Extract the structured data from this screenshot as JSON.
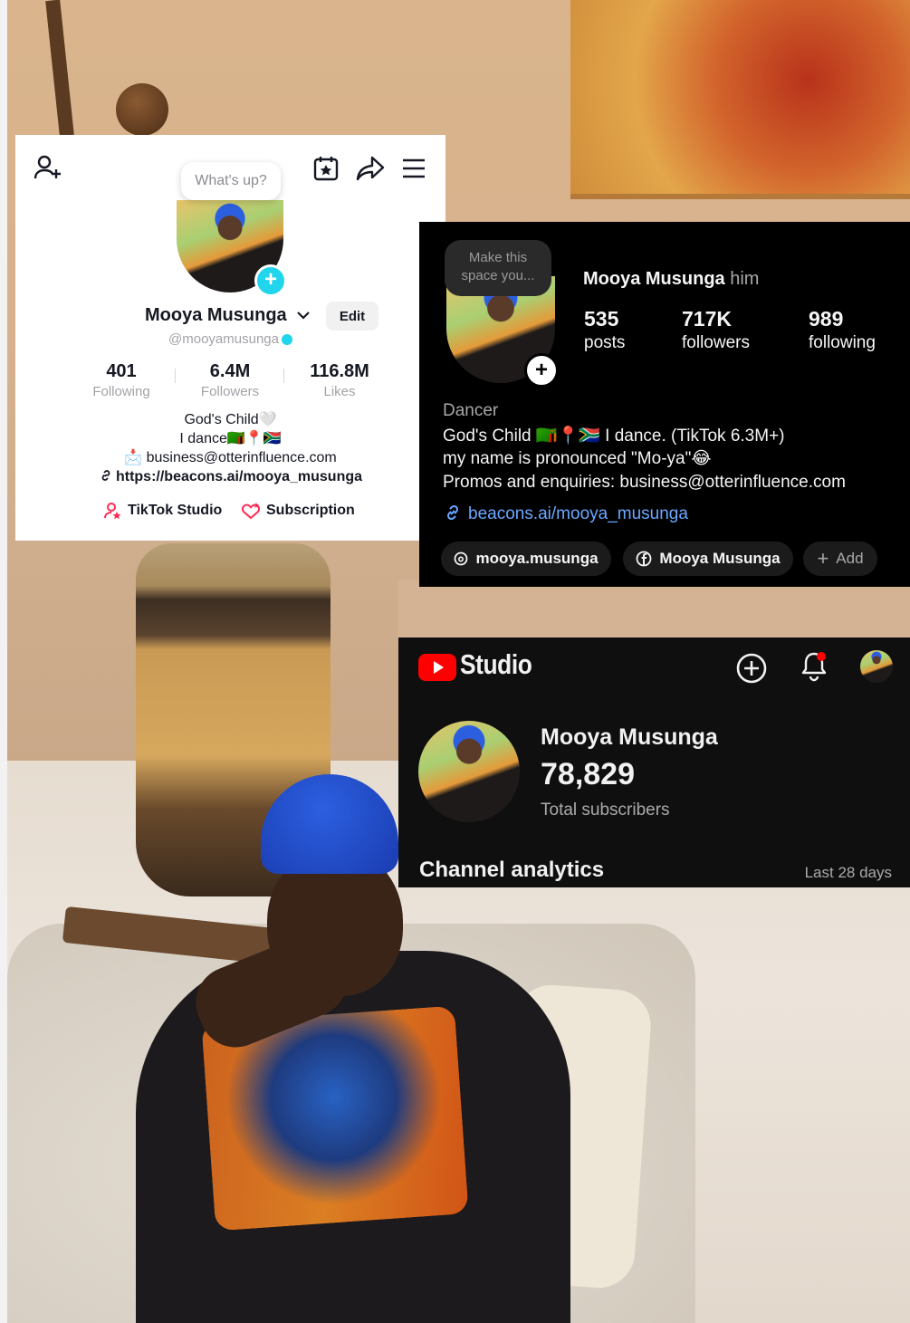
{
  "tiktok": {
    "bubble": "What's up?",
    "name": "Mooya Musunga",
    "edit_label": "Edit",
    "handle": "@mooyamusunga",
    "stats": [
      {
        "value": "401",
        "label": "Following"
      },
      {
        "value": "6.4M",
        "label": "Followers"
      },
      {
        "value": "116.8M",
        "label": "Likes"
      }
    ],
    "bio_line1": "God's Child🤍",
    "bio_line2": "I dance🇿🇲📍🇿🇦",
    "bio_line3": "📩 business@otterinfluence.com",
    "link": "https://beacons.ai/mooya_musunga",
    "studio_label": "TikTok Studio",
    "subscription_label": "Subscription",
    "accent": "#20d5ec",
    "icons": [
      "add-friend-icon",
      "calendar-star-icon",
      "share-icon",
      "menu-icon",
      "link-icon",
      "studio-icon",
      "subscription-icon"
    ]
  },
  "instagram": {
    "bubble_line1": "Make this",
    "bubble_line2": "space you...",
    "name": "Mooya Musunga",
    "pronoun": "him",
    "stats": [
      {
        "value": "535",
        "label": "posts"
      },
      {
        "value": "717K",
        "label": "followers"
      },
      {
        "value": "989",
        "label": "following"
      }
    ],
    "category": "Dancer",
    "bio_line1": "God's Child 🇿🇲📍🇿🇦 I dance. (TikTok 6.3M+)",
    "bio_line2": "my name is pronounced \"Mo-ya\"😂",
    "bio_line3": "Promos and enquiries: business@otterinfluence.com",
    "link": "beacons.ai/mooya_musunga",
    "chips": [
      {
        "label": "mooya.musunga",
        "icon": "threads-icon"
      },
      {
        "label": "Mooya Musunga",
        "icon": "facebook-icon"
      },
      {
        "label": "Add",
        "icon": "plus-icon"
      }
    ],
    "link_color": "#6aa7ff"
  },
  "youtube": {
    "logo_text": "Studio",
    "channel_name": "Mooya Musunga",
    "subscribers": "78,829",
    "subscribers_label": "Total subscribers",
    "analytics_title": "Channel analytics",
    "range_label": "Last 28 days",
    "brand_red": "#ff0000"
  }
}
